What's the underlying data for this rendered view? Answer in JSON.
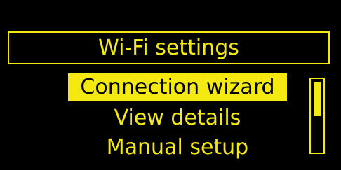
{
  "screen": {
    "title": "Wi-Fi settings"
  },
  "menu": {
    "items": [
      {
        "label": "Connection wizard",
        "selected": true
      },
      {
        "label": "View details",
        "selected": false
      },
      {
        "label": "Manual setup",
        "selected": false
      }
    ]
  },
  "scrollbar": {
    "position_fraction": 0.0,
    "visible_fraction": 0.5
  },
  "colors": {
    "background": "#000000",
    "accent": "#f4ea12"
  }
}
